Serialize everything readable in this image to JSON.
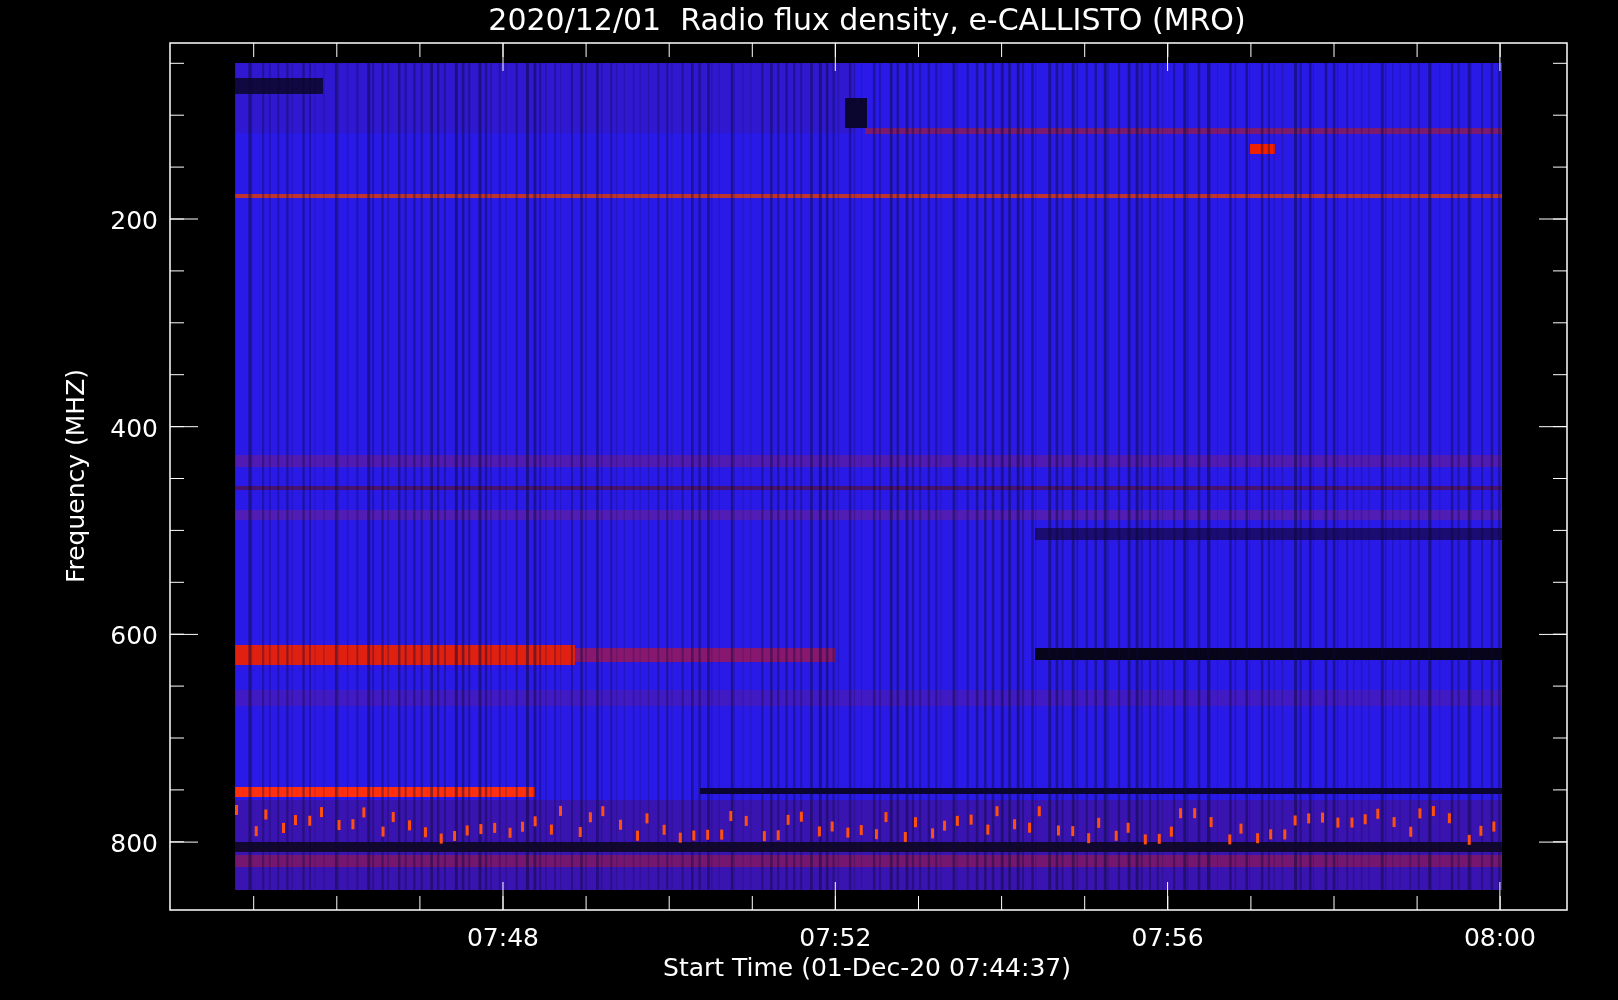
{
  "plot": {
    "title": "2020/12/01  Radio flux density, e-CALLISTO (MRO)",
    "ylabel": "Frequency (MHZ)",
    "xlabel": "Start Time (01-Dec-20 07:44:37)",
    "yticks": [
      "200",
      "400",
      "600",
      "800"
    ],
    "xticks": [
      "07:48",
      "07:52",
      "07:56",
      "08:00"
    ]
  }
}
